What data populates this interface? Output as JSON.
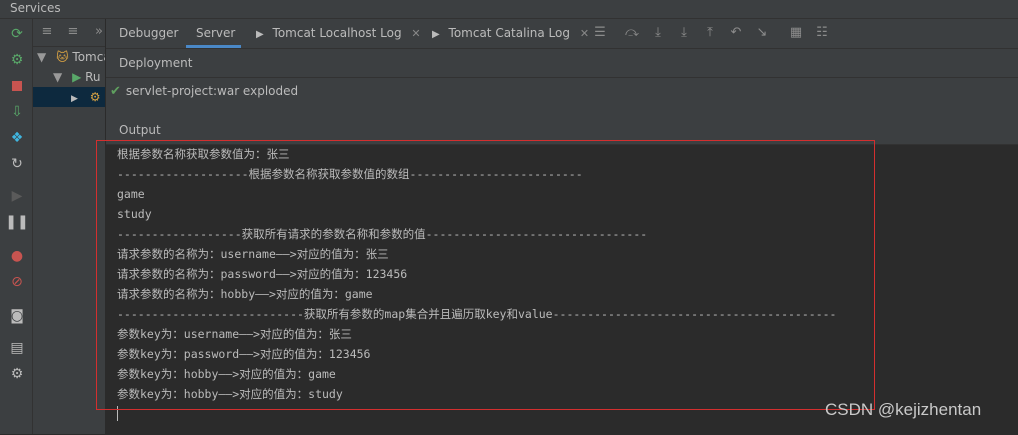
{
  "window": {
    "title": "Services"
  },
  "tree": {
    "nodes": [
      "Tomcat",
      "Ru",
      ""
    ]
  },
  "tabs": [
    {
      "label": "Debugger",
      "active": false
    },
    {
      "label": "Server",
      "active": true
    },
    {
      "label": "Tomcat Localhost Log",
      "active": false,
      "closable": true
    },
    {
      "label": "Tomcat Catalina Log",
      "active": false,
      "closable": true
    }
  ],
  "deployment": {
    "label": "Deployment",
    "item": "servlet-project:war exploded"
  },
  "output": {
    "label": "Output",
    "lines": [
      "根据参数名称获取参数值为：张三",
      "-------------------根据参数名称获取参数值的数组-------------------------",
      "game",
      "study",
      "------------------获取所有请求的参数名称和参数的值--------------------------------",
      "请求参数的名称为：username——>对应的值为：张三",
      "请求参数的名称为：password——>对应的值为：123456",
      "请求参数的名称为：hobby——>对应的值为：game",
      "---------------------------获取所有参数的map集合并且遍历取key和value-----------------------------------------",
      "参数key为：username——>对应的值为：张三",
      "参数key为：password——>对应的值为：123456",
      "参数key为：hobby——>对应的值为：game",
      "参数key为：hobby——>对应的值为：study"
    ]
  },
  "watermark": "CSDN @kejizhentan",
  "colors": {
    "accent": "#4a88c7",
    "highlight_box": "#d32f2f",
    "check": "#5fa05f"
  }
}
